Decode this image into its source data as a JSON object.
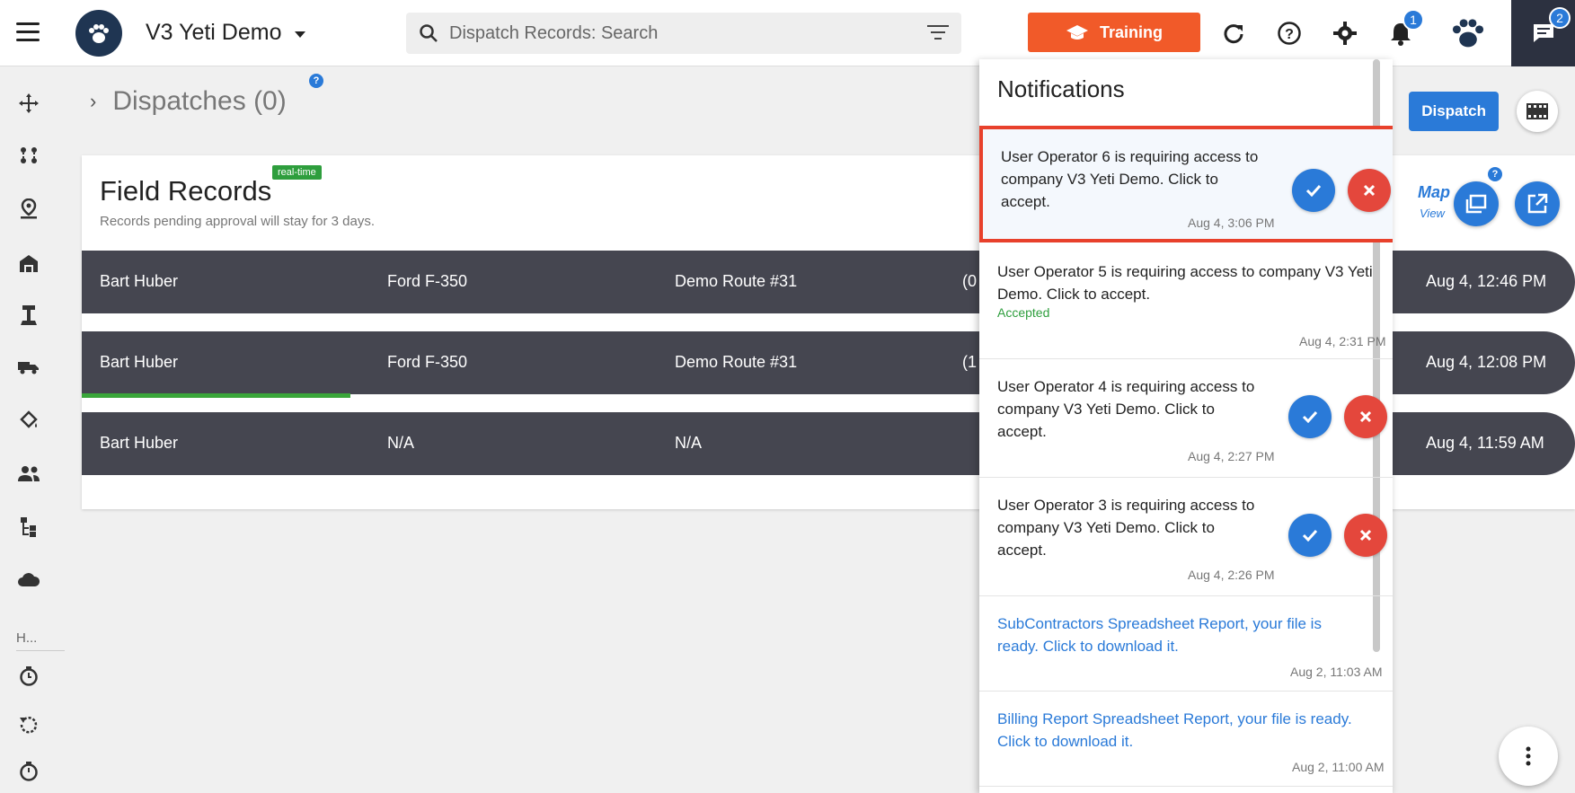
{
  "header": {
    "company_name": "V3 Yeti Demo",
    "search_placeholder": "Dispatch Records: Search",
    "training_label": "Training",
    "notifications_badge": "1",
    "chat_badge": "2"
  },
  "sidebar": {
    "section_label": "H..."
  },
  "main": {
    "breadcrumb": "Dispatches (0)",
    "help": "?",
    "dispatch_button": "Dispatch",
    "map_label": "Map",
    "view_label": "View"
  },
  "field_records": {
    "title": "Field Records",
    "badge": "real-time",
    "subtitle": "Records pending approval will stay for 3 days.",
    "rows": [
      {
        "driver": "Bart Huber",
        "vehicle": "Ford F-350",
        "route": "Demo Route #31",
        "extra": "(0",
        "time": "Aug 4, 12:46 PM"
      },
      {
        "driver": "Bart Huber",
        "vehicle": "Ford F-350",
        "route": "Demo Route #31",
        "extra": "(1",
        "time": "Aug 4, 12:08 PM",
        "progress": 0.18
      },
      {
        "driver": "Bart Huber",
        "vehicle": "N/A",
        "route": "N/A",
        "extra": "",
        "time": "Aug 4, 11:59 AM"
      }
    ]
  },
  "notifications": {
    "title": "Notifications",
    "items": [
      {
        "text": "User Operator 6 is requiring access to company V3 Yeti Demo. Click to accept.",
        "time": "Aug 4, 3:06 PM"
      },
      {
        "text": "User Operator 5 is requiring access to company V3 Yeti Demo. Click to accept.",
        "status": "Accepted",
        "time": "Aug 4, 2:31 PM"
      },
      {
        "text": "User Operator 4 is requiring access to company V3 Yeti Demo. Click to accept.",
        "time": "Aug 4, 2:27 PM"
      },
      {
        "text": "User Operator 3 is requiring access to company V3 Yeti Demo. Click to accept.",
        "time": "Aug 4, 2:26 PM"
      },
      {
        "text": "SubContractors Spreadsheet Report, your file is ready. Click to download it.",
        "time": "Aug 2, 11:03 AM"
      },
      {
        "text": "Billing Report Spreadsheet Report, your file is ready. Click to download it.",
        "time": "Aug 2, 11:00 AM"
      }
    ]
  },
  "colors": {
    "accent_blue": "#2a7ad8",
    "training_orange": "#f15a29",
    "reject_red": "#e4473c",
    "highlight_red": "#e8412c",
    "row_dark": "#454650",
    "accepted_green": "#2e9e3d"
  }
}
